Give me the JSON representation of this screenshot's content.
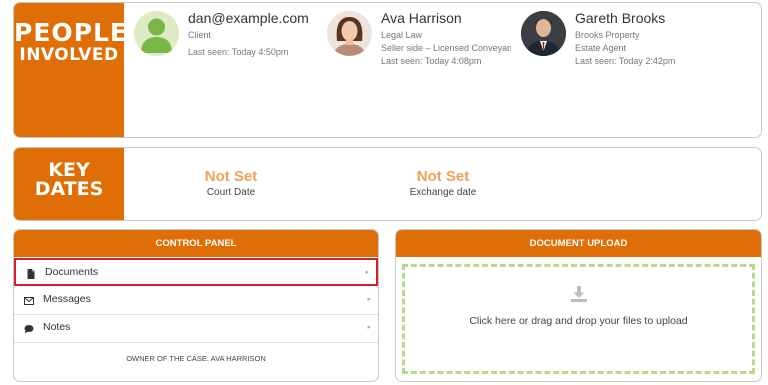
{
  "people_panel": {
    "title_line1": "PEOPLE",
    "title_line2": "INVOLVED",
    "people": [
      {
        "name": "dan@example.com",
        "line1": "Client",
        "line2": "Last seen: Today 4:50pm",
        "line3": "",
        "avatar": "generic-user-icon"
      },
      {
        "name": "Ava Harrison",
        "line1": "Legal Law",
        "line2": "Seller side – Licensed Conveyancer",
        "line3": "Last seen: Today 4:08pm",
        "avatar": "female-photo"
      },
      {
        "name": "Gareth Brooks",
        "line1": "Brooks Property",
        "line2": "Estate Agent",
        "line3": "Last seen: Today 2:42pm",
        "avatar": "male-photo"
      }
    ]
  },
  "key_dates": {
    "title": "KEY DATES",
    "dates": [
      {
        "value": "Not Set",
        "label": "Court Date"
      },
      {
        "value": "Not Set",
        "label": "Exchange date"
      }
    ]
  },
  "control_panel": {
    "header": "CONTROL PANEL",
    "items": [
      {
        "label": "Documents",
        "icon": "file-icon",
        "arrow": "▸"
      },
      {
        "label": "Messages",
        "icon": "envelope-icon",
        "arrow": "▸"
      },
      {
        "label": "Notes",
        "icon": "comment-icon",
        "arrow": "▸"
      }
    ],
    "owner": "OWNER OF THE CASE: AVA HARRISON"
  },
  "document_upload": {
    "header": "DOCUMENT UPLOAD",
    "instruction": "Click here or drag and drop your files to upload",
    "icon": "download-icon"
  },
  "colors": {
    "accent": "#e06e06",
    "date_value": "#f3a055",
    "dropzone_border": "#b9d88a",
    "highlight": "#d0202a"
  }
}
